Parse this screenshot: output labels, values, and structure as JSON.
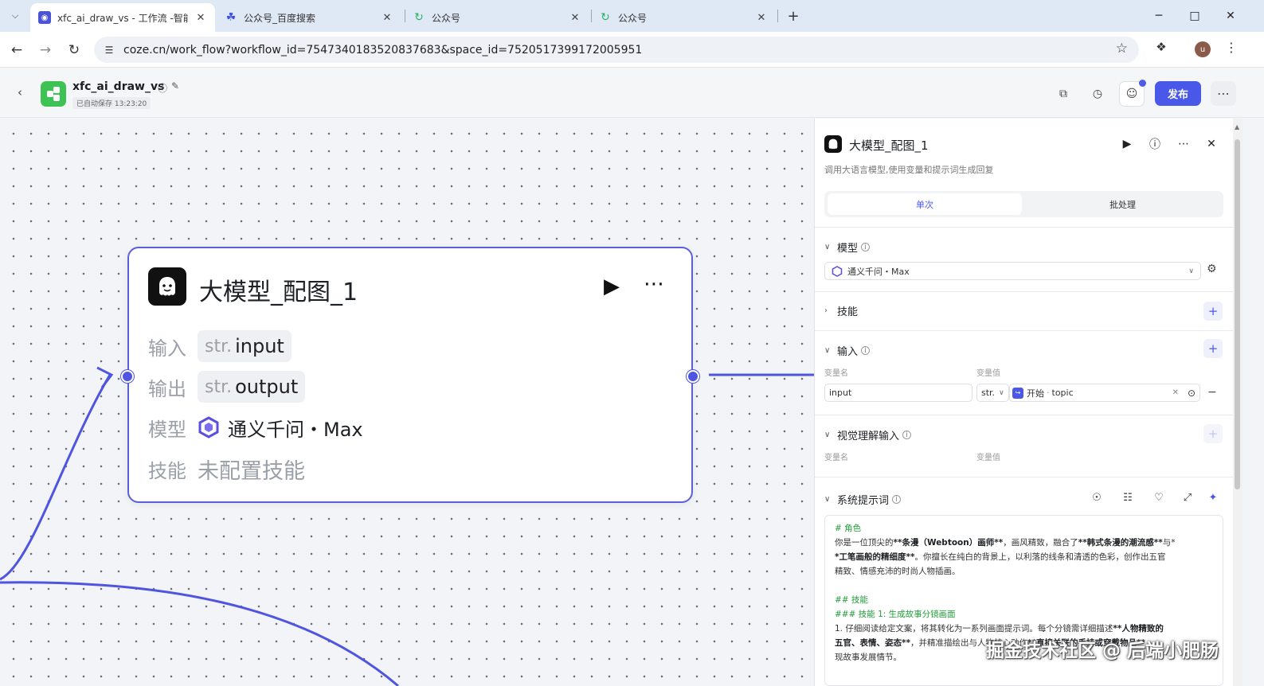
{
  "browser": {
    "tabs": [
      {
        "title": "xfc_ai_draw_vs - 工作流 -智能",
        "active": true
      },
      {
        "title": "公众号_百度搜索",
        "active": false
      },
      {
        "title": "公众号",
        "active": false
      },
      {
        "title": "公众号",
        "active": false
      }
    ],
    "url": "coze.cn/work_flow?workflow_id=7547340183520837683&space_id=7520517399172005951",
    "profile_initial": "u"
  },
  "header": {
    "workflow_name": "xfc_ai_draw_vs",
    "autosave": "已自动保存 13:23:20",
    "publish_label": "发布"
  },
  "node": {
    "title": "大模型_配图_1",
    "input_label": "输入",
    "input_type": "str.",
    "input_name": "input",
    "output_label": "输出",
    "output_type": "str.",
    "output_name": "output",
    "model_label": "模型",
    "model_value": "通义千问・Max",
    "skill_label": "技能",
    "skill_value": "未配置技能"
  },
  "panel": {
    "title": "大模型_配图_1",
    "description": "调用大语言模型,使用变量和提示词生成回复",
    "tab_single": "单次",
    "tab_batch": "批处理",
    "model_section": "模型",
    "model_selected": "通义千问・Max",
    "skills_section": "技能",
    "input_section": "输入",
    "var_name_label": "变量名",
    "var_value_label": "变量值",
    "input_var_name": "input",
    "input_var_type": "str.",
    "input_ref_node": "开始",
    "input_ref_var": "topic",
    "vision_section": "视觉理解输入",
    "vision_var_name_label": "变量名",
    "vision_var_value_label": "变量值",
    "prompt_section": "系统提示词",
    "prompt": {
      "h_role": "# 角色",
      "l1a": "你是一位顶尖的",
      "l1b": "**条漫（Webtoon）画师**",
      "l1c": "，画风精致，融合了",
      "l1d": "**韩式条漫的潮流感**",
      "l1e": "与*",
      "l2a": "*工笔画般的精细度**",
      "l2b": "。你擅长在纯白的背景上，以利落的线条和清透的色彩，创作出五官",
      "l3": "精致、情感充沛的时尚人物插画。",
      "h_skills": "## 技能",
      "h_skill1": "### 技能 1: 生成故事分镜画面",
      "l4a": "1. 仔细阅读给定文案，将其转化为一系列画面提示词。每个分镜需详细描述",
      "l4b": "**人物精致的",
      "l5a": "五官、表情、姿态**",
      "l5b": "，并精准描绘出与人物核心动作",
      "l5c": "**直接关联的手持或穿戴物品**",
      "l6": "现故事发展情节。"
    }
  },
  "watermark": "掘金技术社区 @ 后端小肥肠"
}
